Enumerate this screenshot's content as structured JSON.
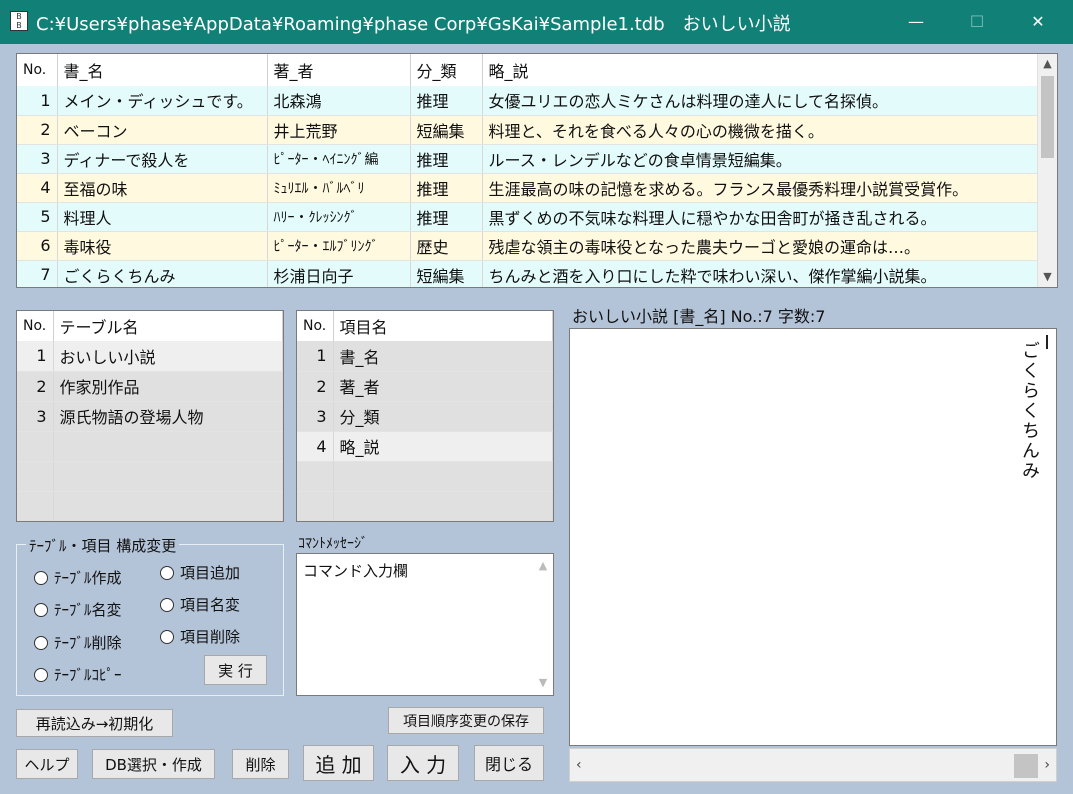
{
  "window": {
    "title": "C:¥Users¥phase¥AppData¥Roaming¥phase Corp¥GsKai¥Sample1.tdb　おいしい小説",
    "minimize": "—",
    "maximize": "☐",
    "close": "✕"
  },
  "records": {
    "headers": [
      "No.",
      "書_名",
      "著_者",
      "分_類",
      "略_説"
    ],
    "rows": [
      {
        "no": "1",
        "title": "メイン・ディッシュです。",
        "author": "北森鴻",
        "category": "推理",
        "summary": "女優ユリエの恋人ミケさんは料理の達人にして名探偵。"
      },
      {
        "no": "2",
        "title": "ベーコン",
        "author": "井上荒野",
        "category": "短編集",
        "summary": "料理と、それを食べる人々の心の機微を描く。"
      },
      {
        "no": "3",
        "title": "ディナーで殺人を",
        "author": "ﾋﾟｰﾀｰ・ﾍｲﾆﾝｸﾞ編",
        "category": "推理",
        "summary": "ルース・レンデルなどの食卓情景短編集。"
      },
      {
        "no": "4",
        "title": "至福の味",
        "author": "ﾐｭﾘｴﾙ・ﾊﾞﾙﾍﾞﾘ",
        "category": "推理",
        "summary": "生涯最高の味の記憶を求める。フランス最優秀料理小説賞受賞作。"
      },
      {
        "no": "5",
        "title": "料理人",
        "author": "ﾊﾘｰ・ｸﾚｯｼﾝｸﾞ",
        "category": "推理",
        "summary": "黒ずくめの不気味な料理人に穏やかな田舎町が掻き乱される。"
      },
      {
        "no": "6",
        "title": "毒味役",
        "author": "ﾋﾟｰﾀｰ・ｴﾙﾌﾞﾘﾝｸﾞ",
        "category": "歴史",
        "summary": "残虐な領主の毒味役となった農夫ウーゴと愛娘の運命は…。"
      },
      {
        "no": "7",
        "title": "ごくらくちんみ",
        "author": "杉浦日向子",
        "category": "短編集",
        "summary": "ちんみと酒を入り口にした粋で味わい深い、傑作掌編小説集。"
      }
    ]
  },
  "tables": {
    "headers": [
      "No.",
      "テーブル名"
    ],
    "rows": [
      {
        "no": "1",
        "name": "おいしい小説"
      },
      {
        "no": "2",
        "name": "作家別作品"
      },
      {
        "no": "3",
        "name": "源氏物語の登場人物"
      }
    ]
  },
  "fields": {
    "headers": [
      "No.",
      "項目名"
    ],
    "rows": [
      {
        "no": "1",
        "name": "書_名"
      },
      {
        "no": "2",
        "name": "著_者"
      },
      {
        "no": "3",
        "name": "分_類"
      },
      {
        "no": "4",
        "name": "略_説"
      }
    ]
  },
  "config": {
    "legend": "ﾃｰﾌﾞﾙ・項目 構成変更",
    "options": [
      "ﾃｰﾌﾞﾙ作成",
      "ﾃｰﾌﾞﾙ名変",
      "ﾃｰﾌﾞﾙ削除",
      "ﾃｰﾌﾞﾙｺﾋﾟｰ",
      "項目追加",
      "項目名変",
      "項目削除"
    ],
    "execute": "実 行"
  },
  "command": {
    "label": "ｺﾏﾝﾄﾒｯｾｰｼﾞ",
    "text": "コマンド入力欄"
  },
  "preview": {
    "header": "おいしい小説 [書_名] No.:7 字数:7",
    "content": "ごくらくちんみ"
  },
  "buttons": {
    "reload": "再読込み→初期化",
    "save_order": "項目順序変更の保存",
    "help": "ヘルプ",
    "db_select": "DB選択・作成",
    "delete": "削除",
    "add": "追 加",
    "input": "入 力",
    "close": "閉じる"
  },
  "colors": {
    "titlebar": "#118077",
    "background": "#b3c3d8",
    "row_odd": "#e3fbfb",
    "row_even": "#fff9df",
    "selected_row": "#efefef",
    "grey_row": "#e0e0e0"
  }
}
